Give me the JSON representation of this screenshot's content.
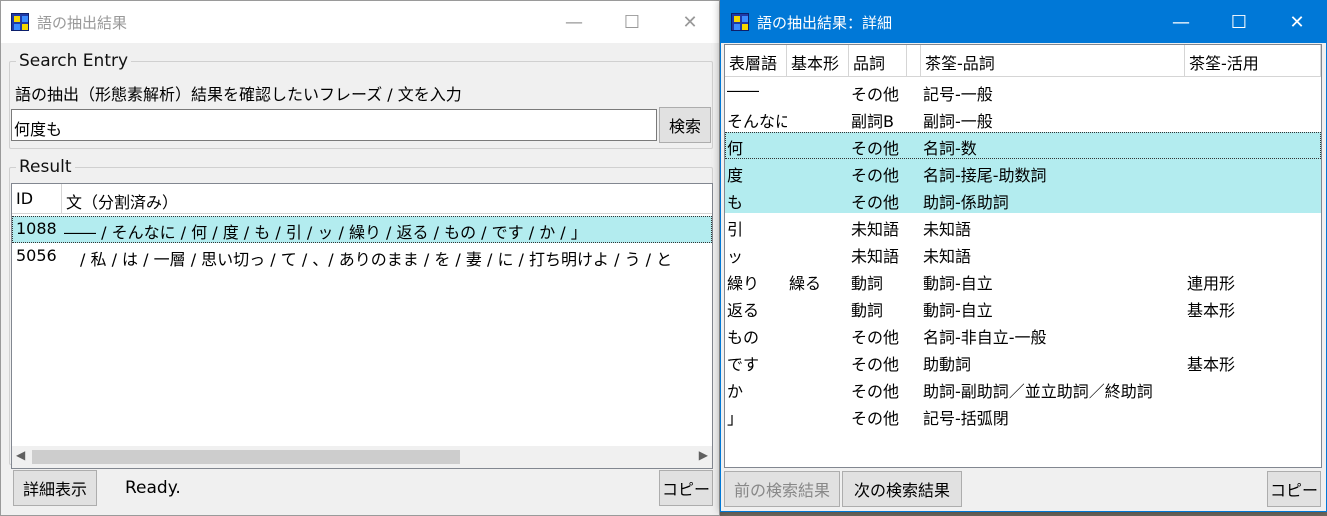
{
  "left_window": {
    "title": "語の抽出結果",
    "caption": {
      "minimize": "—",
      "maximize": "☐",
      "close": "✕"
    },
    "search": {
      "group_label": "Search Entry",
      "prompt": "語の抽出（形態素解析）結果を確認したいフレーズ / 文を入力",
      "input_value": "何度も",
      "search_button": "検索"
    },
    "result": {
      "group_label": "Result",
      "columns": [
        "ID",
        "文（分割済み）"
      ],
      "rows": [
        {
          "id": "1088",
          "text": "―― / そんなに / 何 / 度 / も / 引 / ッ / 繰り / 返る / もの / です / か / 」"
        },
        {
          "id": "5056",
          "text": "/ 私 / は / 一層 / 思い切っ / て / 、/ ありのまま / を / 妻 / に / 打ち明けよ / う / と"
        }
      ]
    },
    "footer": {
      "detail_button": "詳細表示",
      "status": "Ready.",
      "copy_button": "コピー"
    }
  },
  "right_window": {
    "title": "語の抽出結果：詳細",
    "caption": {
      "minimize": "—",
      "maximize": "☐",
      "close": "✕"
    },
    "columns": [
      "表層語",
      "基本形",
      "品詞",
      "",
      "茶筌-品詞",
      "茶筌-活用"
    ],
    "rows": [
      {
        "surface": "――",
        "base": "",
        "pos": "その他",
        "chasen_pos": "記号-一般",
        "conj": ""
      },
      {
        "surface": "そんなに",
        "base": "",
        "pos": "副詞B",
        "chasen_pos": "副詞-一般",
        "conj": ""
      },
      {
        "surface": "何",
        "base": "",
        "pos": "その他",
        "chasen_pos": "名詞-数",
        "conj": ""
      },
      {
        "surface": "度",
        "base": "",
        "pos": "その他",
        "chasen_pos": "名詞-接尾-助数詞",
        "conj": ""
      },
      {
        "surface": "も",
        "base": "",
        "pos": "その他",
        "chasen_pos": "助詞-係助詞",
        "conj": ""
      },
      {
        "surface": "引",
        "base": "",
        "pos": "未知語",
        "chasen_pos": "未知語",
        "conj": ""
      },
      {
        "surface": "ッ",
        "base": "",
        "pos": "未知語",
        "chasen_pos": "未知語",
        "conj": ""
      },
      {
        "surface": "繰り",
        "base": "繰る",
        "pos": "動詞",
        "chasen_pos": "動詞-自立",
        "conj": "連用形"
      },
      {
        "surface": "返る",
        "base": "",
        "pos": "動詞",
        "chasen_pos": "動詞-自立",
        "conj": "基本形"
      },
      {
        "surface": "もの",
        "base": "",
        "pos": "その他",
        "chasen_pos": "名詞-非自立-一般",
        "conj": ""
      },
      {
        "surface": "です",
        "base": "",
        "pos": "その他",
        "chasen_pos": "助動詞",
        "conj": "基本形"
      },
      {
        "surface": "か",
        "base": "",
        "pos": "その他",
        "chasen_pos": "助詞-副助詞／並立助詞／終助詞",
        "conj": ""
      },
      {
        "surface": "」",
        "base": "",
        "pos": "その他",
        "chasen_pos": "記号-括弧閉",
        "conj": ""
      }
    ],
    "footer": {
      "prev_button": "前の検索結果",
      "next_button": "次の検索結果",
      "copy_button": "コピー"
    }
  }
}
